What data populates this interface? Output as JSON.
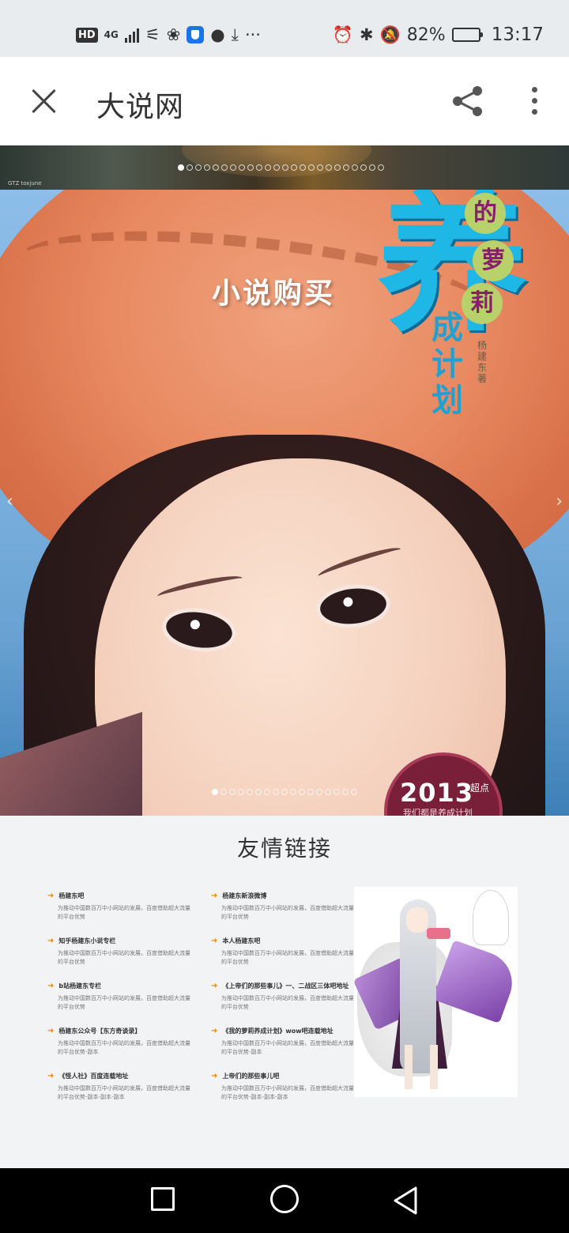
{
  "status_bar": {
    "left_badges": [
      "HD",
      "4G"
    ],
    "battery": "82%",
    "battery_level": 0.82,
    "time": "13:17",
    "icons": [
      "hd-icon",
      "signal-icon",
      "missed-call-icon",
      "huawei-icon",
      "shield-app-icon",
      "message-icon",
      "download-icon",
      "more-notifications-icon",
      "alarm-icon",
      "bluetooth-icon",
      "mute-icon",
      "battery-icon"
    ]
  },
  "app_bar": {
    "title": "大说网",
    "icons": [
      "close-icon",
      "share-icon",
      "more-vert-icon"
    ]
  },
  "top_banner": {
    "caption": "GTZ toxjune",
    "dot_count": 24,
    "active_dot": 0
  },
  "hero_banner": {
    "promo_text": "小说购买",
    "cover_big_char": "养",
    "cover_circle_chars": [
      "的",
      "萝",
      "莉"
    ],
    "cover_vertical": [
      "成",
      "计",
      "划"
    ],
    "cover_small_text": "杨建东著",
    "year": "2013",
    "year_suffix": "超点",
    "year_line": "我们都是养成计划",
    "dot_count": 17,
    "active_dot": 0,
    "arrows": [
      "chevron-left-icon",
      "chevron-right-icon"
    ]
  },
  "friend_links": {
    "title": "友情链接",
    "column_a": [
      {
        "title": "杨建东吧",
        "desc": "为推动中国数百万中小网站的发展，百度借助超大流量的平台优势"
      },
      {
        "title": "知乎杨建东小说专栏",
        "desc": "为推动中国数百万中小网站的发展，百度借助超大流量的平台优势"
      },
      {
        "title": "b站杨建东专栏",
        "desc": "为推动中国数百万中小网站的发展，百度借助超大流量的平台优势"
      },
      {
        "title": "杨建东公众号【东方奇谈录】",
        "desc": "为推动中国数百万中小网站的发展，百度借助超大流量的平台优势-副本"
      },
      {
        "title": "《怪人社》百度连载地址",
        "desc": "为推动中国数百万中小网站的发展，百度借助超大流量的平台优势-副本-副本-副本"
      }
    ],
    "column_b": [
      {
        "title": "杨建东新浪微博",
        "desc": "为推动中国数百万中小网站的发展，百度借助超大流量的平台优势"
      },
      {
        "title": "本人杨建东吧",
        "desc": "为推动中国数百万中小网站的发展，百度借助超大流量的平台优势"
      },
      {
        "title": "《上帝们的那些事儿》一、二战区三体吧地址",
        "desc": "为推动中国数百万中小网站的发展，百度借助超大流量的平台优势"
      },
      {
        "title": "《我的萝莉养成计划》wow吧连载地址",
        "desc": "为推动中国数百万中小网站的发展，百度借助超大流量的平台优势-副本"
      },
      {
        "title": "上帝们的那些事儿吧",
        "desc": "为推动中国数百万中小网站的发展，百度借助超大流量的平台优势-副本-副本-副本"
      }
    ]
  },
  "nav_bar": {
    "icons": [
      "recent-apps-icon",
      "home-icon",
      "back-icon"
    ]
  }
}
